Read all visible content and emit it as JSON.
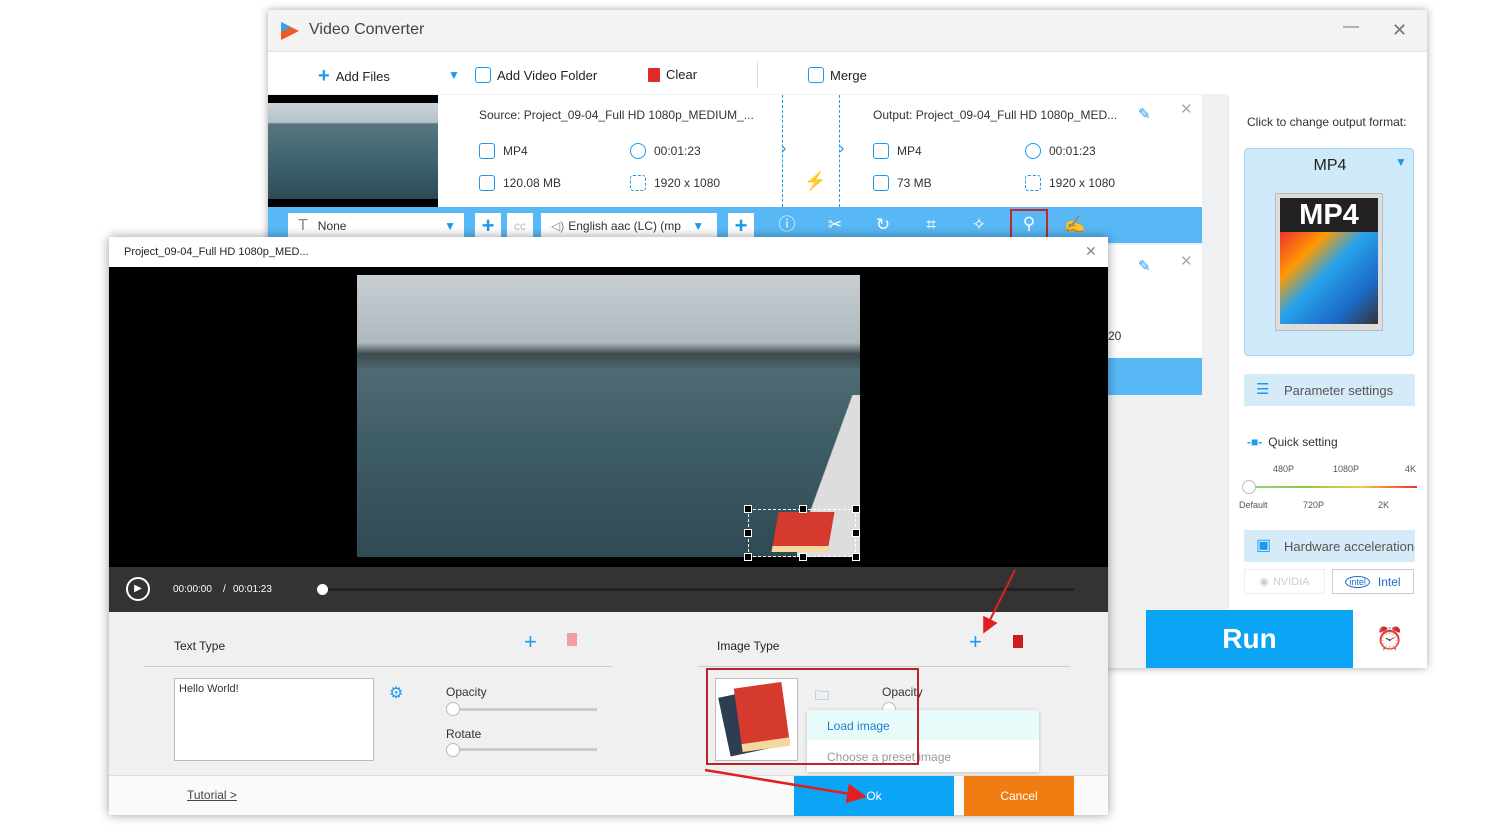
{
  "app": {
    "title": "Video Converter"
  },
  "toolbar": {
    "add_files": "Add Files",
    "add_folder": "Add Video Folder",
    "clear": "Clear",
    "merge": "Merge"
  },
  "file": {
    "source": "Source: Project_09-04_Full HD 1080p_MEDIUM_...",
    "source_format": "MP4",
    "source_duration": "00:01:23",
    "source_size": "120.08 MB",
    "source_resolution": "1920 x 1080",
    "output": "Output: Project_09-04_Full HD 1080p_MED...",
    "output_format": "MP4",
    "output_duration": "00:01:23",
    "output_size": "73 MB",
    "output_resolution": "1920 x 1080"
  },
  "edit_bar": {
    "subtitle": "None",
    "audio": "English aac (LC) (mp"
  },
  "second_file": {
    "resolution_partial": "20"
  },
  "right_panel": {
    "format_hint": "Click to change output format:",
    "format": "MP4",
    "format_icon_text": "MP4",
    "parameter_settings": "Parameter settings",
    "quick_setting": "Quick setting",
    "quality_top": [
      "480P",
      "1080P",
      "4K"
    ],
    "quality_bottom": [
      "Default",
      "720P",
      "2K"
    ],
    "quality_value": "Default",
    "hardware_acceleration": "Hardware acceleration",
    "nvidia": "NVIDIA",
    "intel": "Intel",
    "intel_logo": "intel"
  },
  "run": "Run",
  "dialog": {
    "title": "Project_09-04_Full HD 1080p_MED...",
    "current_time": "00:00:00",
    "separator": "/",
    "total_time": "00:01:23",
    "progress": 0,
    "text_type": "Text Type",
    "text_value": "Hello World!",
    "opacity": "Opacity",
    "rotate": "Rotate",
    "image_type": "Image Type",
    "image_opacity": "Opacity",
    "menu": [
      "Load image",
      "Choose a preset image"
    ],
    "tutorial": "Tutorial >",
    "ok": "Ok",
    "cancel": "Cancel"
  },
  "colors": {
    "accent": "#1a9aef",
    "run": "#0ca5f5",
    "cancel": "#f07c12",
    "annotation": "#e02020"
  }
}
